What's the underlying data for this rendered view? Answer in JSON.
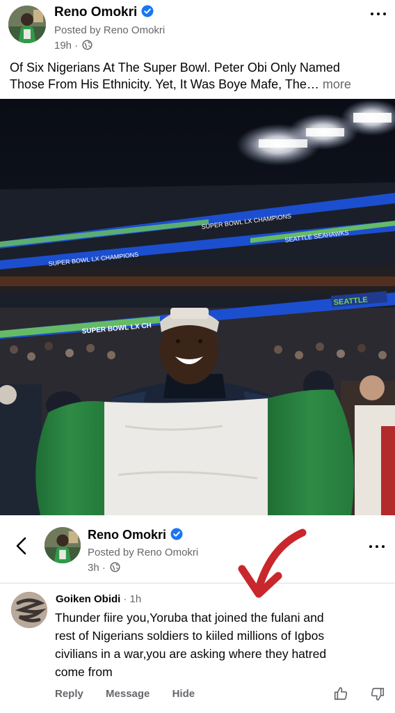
{
  "post": {
    "author": "Reno Omokri",
    "posted_by": "Posted by Reno Omokri",
    "time": "19h",
    "text_line1": "Of Six Nigerians At The Super Bowl. Peter Obi Only Named",
    "text_line2": "Those From His Ethnicity. Yet, It Was Boye Mafe, The…",
    "more_label": "more"
  },
  "photo": {
    "ribbon_text_1": "SUPER BOWL LX CHAMPIONS",
    "ribbon_text_2": "SEATTLE SEAHAWKS",
    "ribbon_text_3": "SEATTLE",
    "ribbon_text_4": "SUPER BOWL LX CH"
  },
  "overlay": {
    "author": "Reno Omokri",
    "posted_by": "Posted by Reno Omokri",
    "time": "3h"
  },
  "comment": {
    "name": "Goiken Obidi",
    "time": "· 1h",
    "line1": "Thunder fiire you,Yoruba that joined the fulani and",
    "line2": "rest of Nigerians soldiers to kiiled millions of Igbos",
    "line3": "civilians in a war,you are asking where they hatred",
    "line4": "come from",
    "reply_label": "Reply",
    "message_label": "Message",
    "hide_label": "Hide"
  },
  "colors": {
    "verified_blue": "#1877f2",
    "secondary_text": "#65676b",
    "arrow_red": "#c8282c",
    "flag_green": "#2e8b45"
  },
  "icons": [
    "verified-badge-icon",
    "globe-icon",
    "more-options-icon",
    "back-chevron-icon",
    "thumbs-up-icon",
    "thumbs-down-icon",
    "red-arrow-annotation"
  ]
}
